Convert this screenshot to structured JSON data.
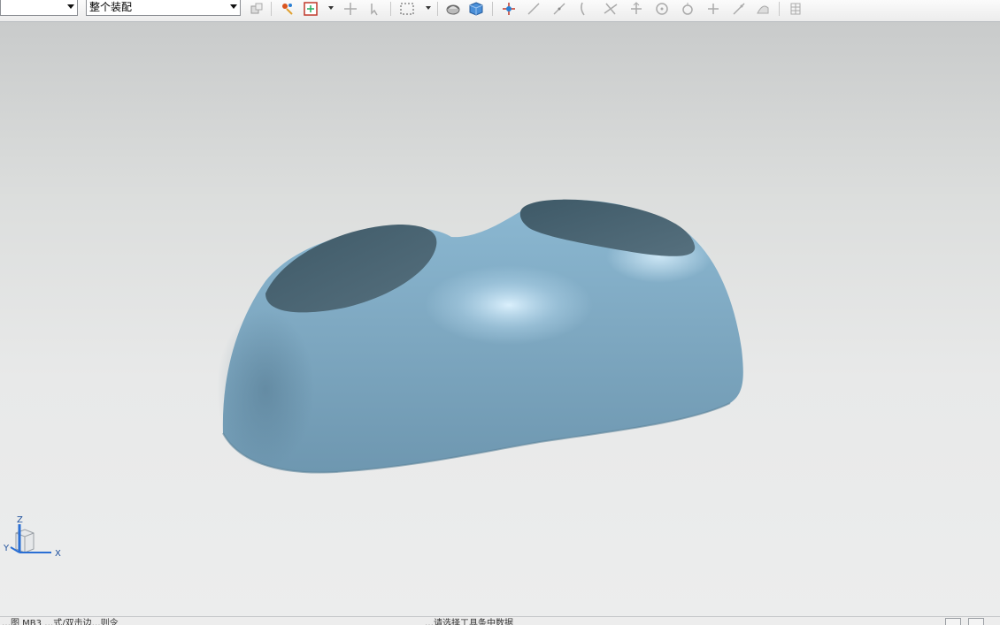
{
  "toolbar": {
    "filter_combo": {
      "value": ""
    },
    "scope_combo": {
      "value": "整个装配"
    }
  },
  "view_triad": {
    "z_label": "Z",
    "y_label": "Y",
    "x_label": "X"
  },
  "status": {
    "left_text": "…图 MB3 …式/双击边…则令",
    "center_text": "…请选择工具条中数据"
  },
  "colors": {
    "model": "#8ab4cc",
    "background": "#e4e6e6",
    "toolbar": "#f4f4f4"
  }
}
